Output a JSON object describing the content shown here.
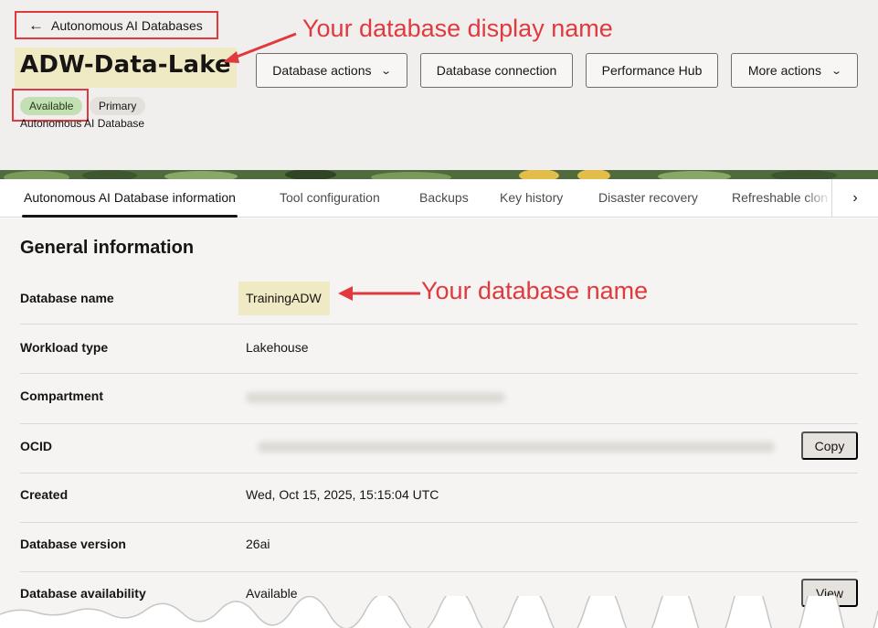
{
  "header": {
    "back_link": {
      "icon": "arrow-left-icon",
      "label": "Autonomous AI Databases"
    },
    "title": "ADW-Data-Lake",
    "badges": {
      "available": "Available",
      "primary": "Primary"
    },
    "subtitle": "Autonomous AI Database",
    "actions": {
      "database_actions": "Database actions",
      "database_connection": "Database connection",
      "performance_hub": "Performance Hub",
      "more_actions": "More actions"
    }
  },
  "annotations": {
    "display_name": "Your database display name",
    "database_name": "Your database name"
  },
  "tabs": [
    {
      "label": "Autonomous AI Database information",
      "active": true
    },
    {
      "label": "Tool configuration"
    },
    {
      "label": "Backups"
    },
    {
      "label": "Key history"
    },
    {
      "label": "Disaster recovery"
    },
    {
      "label": "Refreshable clon"
    }
  ],
  "general_info": {
    "title": "General information",
    "rows": [
      {
        "label": "Database name",
        "value": "TrainingADW"
      },
      {
        "label": "Workload type",
        "value": "Lakehouse"
      },
      {
        "label": "Compartment",
        "value": ""
      },
      {
        "label": "OCID",
        "value": "",
        "button": "Copy"
      },
      {
        "label": "Created",
        "value": "Wed, Oct 15, 2025, 15:15:04 UTC"
      },
      {
        "label": "Database version",
        "value": "26ai"
      },
      {
        "label": "Database availability",
        "value": "Available",
        "button": "View"
      }
    ]
  },
  "colors": {
    "annotation_red": "#e0393e",
    "highlight_yellow": "#efe9c4",
    "available_green": "#c5dfb5"
  }
}
